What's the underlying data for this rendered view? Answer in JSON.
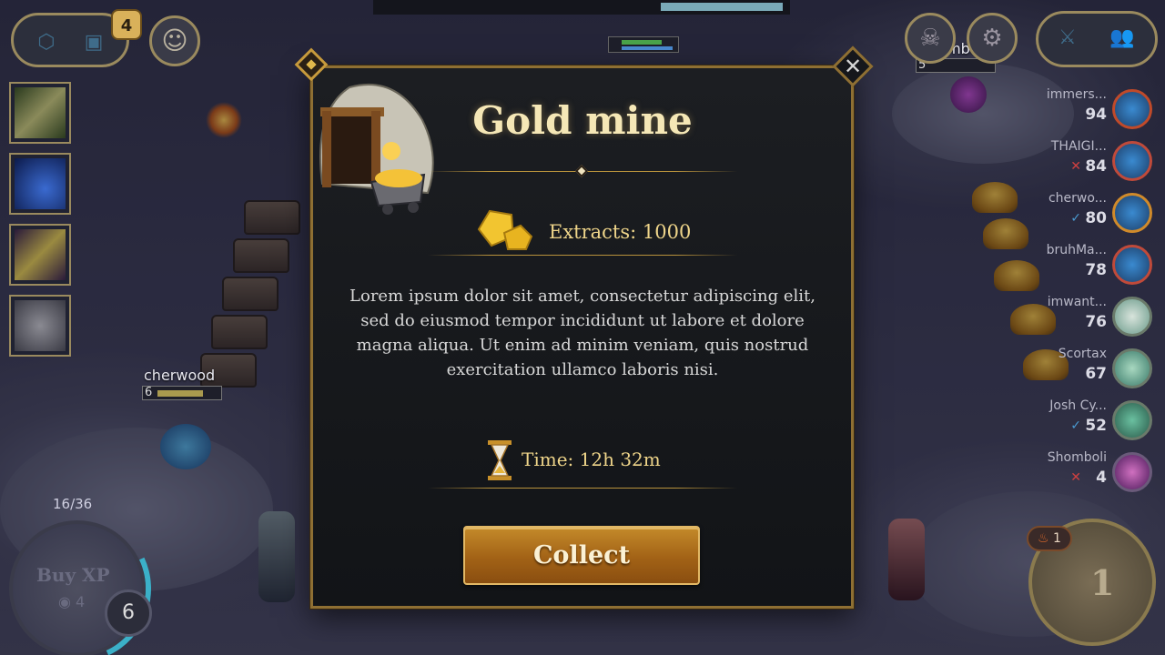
{
  "hud": {
    "notification_count": "4",
    "xp_progress": "16/36",
    "buy_xp_label": "Buy XP",
    "buy_xp_cost": "4",
    "player_level": "6",
    "gold": "1",
    "streak": "1"
  },
  "board_player": {
    "name": "cherwood",
    "level": "5"
  },
  "enemy_player": {
    "name": "Shomboli",
    "level": "5"
  },
  "board_player_level": "6",
  "scoreboard": [
    {
      "name": "immers...",
      "hp": "94",
      "mark": ""
    },
    {
      "name": "THAIGI...",
      "hp": "84",
      "mark": "✕"
    },
    {
      "name": "cherwo...",
      "hp": "80",
      "mark": "✓"
    },
    {
      "name": "bruhMa...",
      "hp": "78",
      "mark": ""
    },
    {
      "name": "imwant...",
      "hp": "76",
      "mark": ""
    },
    {
      "name": "Scortax",
      "hp": "67",
      "mark": ""
    },
    {
      "name": "Josh Cy...",
      "hp": "52",
      "mark": "✓"
    },
    {
      "name": "Shomboli",
      "hp": "4",
      "mark": "✕"
    }
  ],
  "modal": {
    "title": "Gold mine",
    "extracts": "Extracts: 1000",
    "description": "Lorem ipsum dolor sit amet, consectetur adipiscing elit, sed do eiusmod tempor incididunt ut labore et dolore magna aliqua. Ut enim ad minim veniam, quis nostrud exercitation ullamco laboris nisi.",
    "time": "Time: 12h 32m",
    "collect_label": "Collect",
    "close_symbol": "✕"
  },
  "colors": {
    "modal_border": "#8e6f33",
    "accent_gold": "#efd58a",
    "button": "#a26216"
  }
}
